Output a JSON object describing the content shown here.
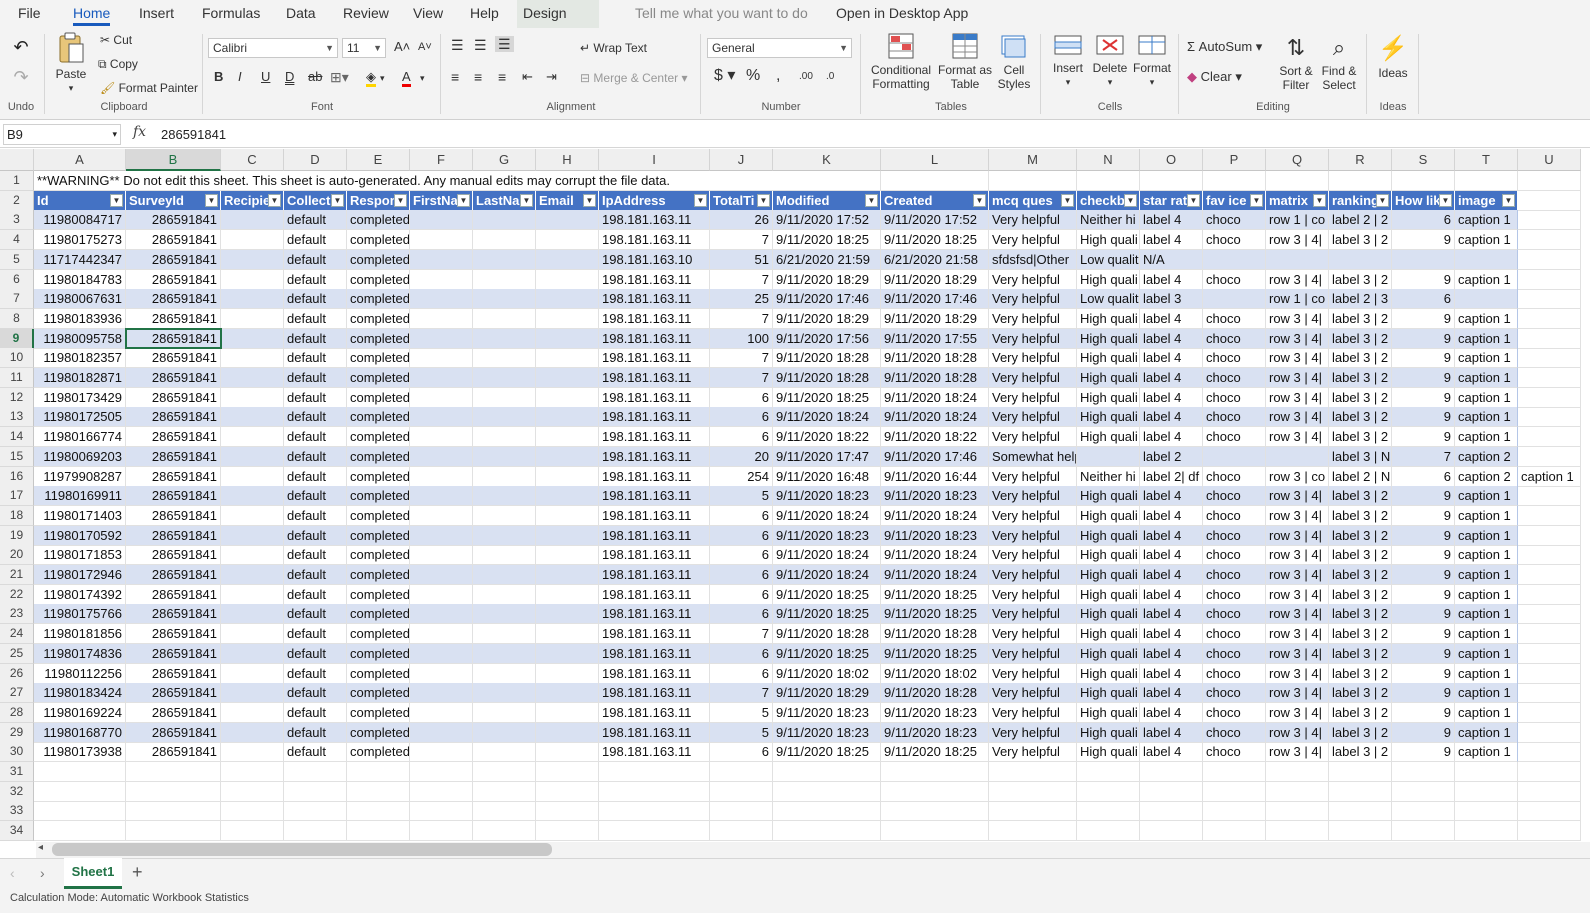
{
  "menu": {
    "file": "File",
    "home": "Home",
    "insert": "Insert",
    "formulas": "Formulas",
    "data": "Data",
    "review": "Review",
    "view": "View",
    "help": "Help",
    "design": "Design",
    "tell": "Tell me what you want to do",
    "open_desktop": "Open in Desktop App"
  },
  "ribbon": {
    "undo_group": "Undo",
    "paste": "Paste",
    "cut": "Cut",
    "copy": "Copy",
    "format_painter": "Format Painter",
    "clipboard_group": "Clipboard",
    "font_name": "Calibri",
    "font_size": "11",
    "font_group": "Font",
    "wrap_text": "Wrap Text",
    "merge_center": "Merge & Center",
    "alignment_group": "Alignment",
    "number_format": "General",
    "number_group": "Number",
    "conditional_formatting": "Conditional Formatting",
    "format_as_table": "Format as Table",
    "cell_styles": "Cell Styles",
    "tables_group": "Tables",
    "insert": "Insert",
    "delete": "Delete",
    "format": "Format",
    "cells_group": "Cells",
    "autosum": "AutoSum",
    "clear": "Clear",
    "sort_filter": "Sort & Filter",
    "find_select": "Find & Select",
    "editing_group": "Editing",
    "ideas": "Ideas",
    "ideas_group": "Ideas"
  },
  "formula_bar": {
    "name_box": "B9",
    "fx": "fx",
    "value": "286591841"
  },
  "columns": [
    "A",
    "B",
    "C",
    "D",
    "E",
    "F",
    "G",
    "H",
    "I",
    "J",
    "K",
    "L",
    "M",
    "N",
    "O",
    "P",
    "Q",
    "R",
    "S",
    "T",
    "U"
  ],
  "row_numbers": [
    "1",
    "2",
    "3",
    "4",
    "5",
    "6",
    "7",
    "8",
    "9",
    "10",
    "11",
    "12",
    "13",
    "14",
    "15",
    "16",
    "17",
    "18",
    "19",
    "20",
    "21",
    "22",
    "23",
    "24",
    "25",
    "26",
    "27",
    "28",
    "29",
    "30",
    "31",
    "32",
    "33",
    "34"
  ],
  "warning": "**WARNING** Do not edit this sheet. This sheet is auto-generated. Any manual edits may corrupt the file data.",
  "headers": [
    "Id",
    "SurveyId",
    "Recipie",
    "Collect",
    "Respon",
    "FirstNa",
    "LastNa",
    "Email",
    "IpAddress",
    "TotalTi",
    "Modified",
    "Created",
    "mcq ques",
    "checkb",
    "star rat",
    "fav ice",
    "matrix",
    "ranking",
    "How lik",
    "image"
  ],
  "rows": [
    [
      "11980084717",
      "286591841",
      "",
      "default",
      "completed",
      "",
      "",
      "",
      "198.181.163.11",
      "26",
      "9/11/2020 17:52",
      "9/11/2020 17:52",
      "Very helpful",
      "Neither hi",
      "label 4",
      "choco",
      "row 1 | co",
      "label 2 | 2",
      "6",
      "caption 1",
      ""
    ],
    [
      "11980175273",
      "286591841",
      "",
      "default",
      "completed",
      "",
      "",
      "",
      "198.181.163.11",
      "7",
      "9/11/2020 18:25",
      "9/11/2020 18:25",
      "Very helpful",
      "High quali",
      "label 4",
      "choco",
      "row 3 | 4|",
      "label 3 | 2",
      "9",
      "caption 1",
      ""
    ],
    [
      "11717442347",
      "286591841",
      "",
      "default",
      "completed",
      "",
      "",
      "",
      "198.181.163.10",
      "51",
      "6/21/2020 21:59",
      "6/21/2020 21:58",
      "sfdsfsd|Other",
      "Low qualit",
      "N/A",
      "",
      "",
      "",
      "",
      "",
      ""
    ],
    [
      "11980184783",
      "286591841",
      "",
      "default",
      "completed",
      "",
      "",
      "",
      "198.181.163.11",
      "7",
      "9/11/2020 18:29",
      "9/11/2020 18:29",
      "Very helpful",
      "High quali",
      "label 4",
      "choco",
      "row 3 | 4|",
      "label 3 | 2",
      "9",
      "caption 1",
      ""
    ],
    [
      "11980067631",
      "286591841",
      "",
      "default",
      "completed",
      "",
      "",
      "",
      "198.181.163.11",
      "25",
      "9/11/2020 17:46",
      "9/11/2020 17:46",
      "Very helpful",
      "Low qualit",
      "label 3",
      "",
      "row 1 | co",
      "label 2 | 3",
      "6",
      "",
      ""
    ],
    [
      "11980183936",
      "286591841",
      "",
      "default",
      "completed",
      "",
      "",
      "",
      "198.181.163.11",
      "7",
      "9/11/2020 18:29",
      "9/11/2020 18:29",
      "Very helpful",
      "High quali",
      "label 4",
      "choco",
      "row 3 | 4|",
      "label 3 | 2",
      "9",
      "caption 1",
      ""
    ],
    [
      "11980095758",
      "286591841",
      "",
      "default",
      "completed",
      "",
      "",
      "",
      "198.181.163.11",
      "100",
      "9/11/2020 17:56",
      "9/11/2020 17:55",
      "Very helpful",
      "High quali",
      "label 4",
      "choco",
      "row 3 | 4|",
      "label 3 | 2",
      "9",
      "caption 1",
      ""
    ],
    [
      "11980182357",
      "286591841",
      "",
      "default",
      "completed",
      "",
      "",
      "",
      "198.181.163.11",
      "7",
      "9/11/2020 18:28",
      "9/11/2020 18:28",
      "Very helpful",
      "High quali",
      "label 4",
      "choco",
      "row 3 | 4|",
      "label 3 | 2",
      "9",
      "caption 1",
      ""
    ],
    [
      "11980182871",
      "286591841",
      "",
      "default",
      "completed",
      "",
      "",
      "",
      "198.181.163.11",
      "7",
      "9/11/2020 18:28",
      "9/11/2020 18:28",
      "Very helpful",
      "High quali",
      "label 4",
      "choco",
      "row 3 | 4|",
      "label 3 | 2",
      "9",
      "caption 1",
      ""
    ],
    [
      "11980173429",
      "286591841",
      "",
      "default",
      "completed",
      "",
      "",
      "",
      "198.181.163.11",
      "6",
      "9/11/2020 18:25",
      "9/11/2020 18:24",
      "Very helpful",
      "High quali",
      "label 4",
      "choco",
      "row 3 | 4|",
      "label 3 | 2",
      "9",
      "caption 1",
      ""
    ],
    [
      "11980172505",
      "286591841",
      "",
      "default",
      "completed",
      "",
      "",
      "",
      "198.181.163.11",
      "6",
      "9/11/2020 18:24",
      "9/11/2020 18:24",
      "Very helpful",
      "High quali",
      "label 4",
      "choco",
      "row 3 | 4|",
      "label 3 | 2",
      "9",
      "caption 1",
      ""
    ],
    [
      "11980166774",
      "286591841",
      "",
      "default",
      "completed",
      "",
      "",
      "",
      "198.181.163.11",
      "6",
      "9/11/2020 18:22",
      "9/11/2020 18:22",
      "Very helpful",
      "High quali",
      "label 4",
      "choco",
      "row 3 | 4|",
      "label 3 | 2",
      "9",
      "caption 1",
      ""
    ],
    [
      "11980069203",
      "286591841",
      "",
      "default",
      "completed",
      "",
      "",
      "",
      "198.181.163.11",
      "20",
      "9/11/2020 17:47",
      "9/11/2020 17:46",
      "Somewhat helpful",
      "",
      "label 2",
      "",
      "",
      "label 3 | N",
      "7",
      "caption 2",
      ""
    ],
    [
      "11979908287",
      "286591841",
      "",
      "default",
      "completed",
      "",
      "",
      "",
      "198.181.163.11",
      "254",
      "9/11/2020 16:48",
      "9/11/2020 16:44",
      "Very helpful",
      "Neither hi",
      "label 2| df",
      "choco",
      "row 3 | co",
      "label 2 | N",
      "6",
      "caption 2",
      "caption 1"
    ],
    [
      "11980169911",
      "286591841",
      "",
      "default",
      "completed",
      "",
      "",
      "",
      "198.181.163.11",
      "5",
      "9/11/2020 18:23",
      "9/11/2020 18:23",
      "Very helpful",
      "High quali",
      "label 4",
      "choco",
      "row 3 | 4|",
      "label 3 | 2",
      "9",
      "caption 1",
      ""
    ],
    [
      "11980171403",
      "286591841",
      "",
      "default",
      "completed",
      "",
      "",
      "",
      "198.181.163.11",
      "6",
      "9/11/2020 18:24",
      "9/11/2020 18:24",
      "Very helpful",
      "High quali",
      "label 4",
      "choco",
      "row 3 | 4|",
      "label 3 | 2",
      "9",
      "caption 1",
      ""
    ],
    [
      "11980170592",
      "286591841",
      "",
      "default",
      "completed",
      "",
      "",
      "",
      "198.181.163.11",
      "6",
      "9/11/2020 18:23",
      "9/11/2020 18:23",
      "Very helpful",
      "High quali",
      "label 4",
      "choco",
      "row 3 | 4|",
      "label 3 | 2",
      "9",
      "caption 1",
      ""
    ],
    [
      "11980171853",
      "286591841",
      "",
      "default",
      "completed",
      "",
      "",
      "",
      "198.181.163.11",
      "6",
      "9/11/2020 18:24",
      "9/11/2020 18:24",
      "Very helpful",
      "High quali",
      "label 4",
      "choco",
      "row 3 | 4|",
      "label 3 | 2",
      "9",
      "caption 1",
      ""
    ],
    [
      "11980172946",
      "286591841",
      "",
      "default",
      "completed",
      "",
      "",
      "",
      "198.181.163.11",
      "6",
      "9/11/2020 18:24",
      "9/11/2020 18:24",
      "Very helpful",
      "High quali",
      "label 4",
      "choco",
      "row 3 | 4|",
      "label 3 | 2",
      "9",
      "caption 1",
      ""
    ],
    [
      "11980174392",
      "286591841",
      "",
      "default",
      "completed",
      "",
      "",
      "",
      "198.181.163.11",
      "6",
      "9/11/2020 18:25",
      "9/11/2020 18:25",
      "Very helpful",
      "High quali",
      "label 4",
      "choco",
      "row 3 | 4|",
      "label 3 | 2",
      "9",
      "caption 1",
      ""
    ],
    [
      "11980175766",
      "286591841",
      "",
      "default",
      "completed",
      "",
      "",
      "",
      "198.181.163.11",
      "6",
      "9/11/2020 18:25",
      "9/11/2020 18:25",
      "Very helpful",
      "High quali",
      "label 4",
      "choco",
      "row 3 | 4|",
      "label 3 | 2",
      "9",
      "caption 1",
      ""
    ],
    [
      "11980181856",
      "286591841",
      "",
      "default",
      "completed",
      "",
      "",
      "",
      "198.181.163.11",
      "7",
      "9/11/2020 18:28",
      "9/11/2020 18:28",
      "Very helpful",
      "High quali",
      "label 4",
      "choco",
      "row 3 | 4|",
      "label 3 | 2",
      "9",
      "caption 1",
      ""
    ],
    [
      "11980174836",
      "286591841",
      "",
      "default",
      "completed",
      "",
      "",
      "",
      "198.181.163.11",
      "6",
      "9/11/2020 18:25",
      "9/11/2020 18:25",
      "Very helpful",
      "High quali",
      "label 4",
      "choco",
      "row 3 | 4|",
      "label 3 | 2",
      "9",
      "caption 1",
      ""
    ],
    [
      "11980112256",
      "286591841",
      "",
      "default",
      "completed",
      "",
      "",
      "",
      "198.181.163.11",
      "6",
      "9/11/2020 18:02",
      "9/11/2020 18:02",
      "Very helpful",
      "High quali",
      "label 4",
      "choco",
      "row 3 | 4|",
      "label 3 | 2",
      "9",
      "caption 1",
      ""
    ],
    [
      "11980183424",
      "286591841",
      "",
      "default",
      "completed",
      "",
      "",
      "",
      "198.181.163.11",
      "7",
      "9/11/2020 18:29",
      "9/11/2020 18:28",
      "Very helpful",
      "High quali",
      "label 4",
      "choco",
      "row 3 | 4|",
      "label 3 | 2",
      "9",
      "caption 1",
      ""
    ],
    [
      "11980169224",
      "286591841",
      "",
      "default",
      "completed",
      "",
      "",
      "",
      "198.181.163.11",
      "5",
      "9/11/2020 18:23",
      "9/11/2020 18:23",
      "Very helpful",
      "High quali",
      "label 4",
      "choco",
      "row 3 | 4|",
      "label 3 | 2",
      "9",
      "caption 1",
      ""
    ],
    [
      "11980168770",
      "286591841",
      "",
      "default",
      "completed",
      "",
      "",
      "",
      "198.181.163.11",
      "5",
      "9/11/2020 18:23",
      "9/11/2020 18:23",
      "Very helpful",
      "High quali",
      "label 4",
      "choco",
      "row 3 | 4|",
      "label 3 | 2",
      "9",
      "caption 1",
      ""
    ],
    [
      "11980173938",
      "286591841",
      "",
      "default",
      "completed",
      "",
      "",
      "",
      "198.181.163.11",
      "6",
      "9/11/2020 18:25",
      "9/11/2020 18:25",
      "Very helpful",
      "High quali",
      "label 4",
      "choco",
      "row 3 | 4|",
      "label 3 | 2",
      "9",
      "caption 1",
      ""
    ]
  ],
  "sheet_tabs": [
    "Sheet1"
  ],
  "add_sheet": "+",
  "status": "Calculation Mode: Automatic    Workbook Statistics",
  "colors": {
    "accent": "#217346",
    "header_blue": "#4472c4",
    "band": "#d9e1f2",
    "home_blue": "#185abd"
  }
}
